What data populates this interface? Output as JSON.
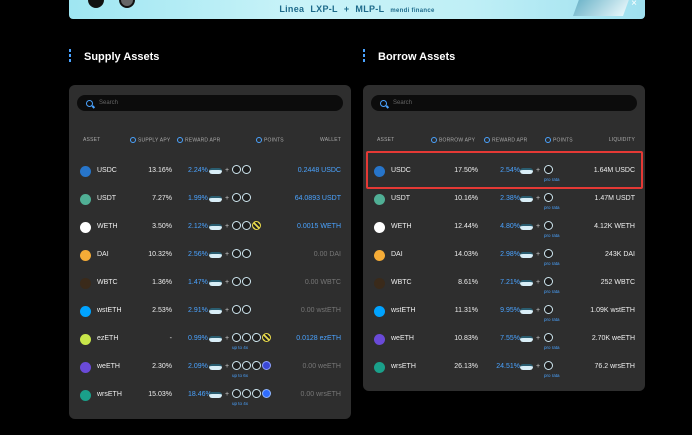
{
  "banner": {
    "left": "Linea",
    "mid1": "LXP-L",
    "plus": "+",
    "mid2": "MLP-L",
    "partner": "mendi finance",
    "close": "×"
  },
  "supply": {
    "title": "Supply Assets",
    "search_placeholder": "Search",
    "headers": {
      "asset": "ASSET",
      "apy": "SUPPLY APY",
      "reward": "REWARD APR",
      "points": "POINTS",
      "wallet": "WALLET"
    },
    "rows": [
      {
        "name": "USDC",
        "apy": "13.16%",
        "reward": "2.24%",
        "sub": "",
        "wallet": "0.2448 USDC",
        "wallet_blue": true,
        "icon_color": "#2775ca",
        "pts": [
          "n",
          "n"
        ]
      },
      {
        "name": "USDT",
        "apy": "7.27%",
        "reward": "1.99%",
        "sub": "",
        "wallet": "64.0893 USDT",
        "wallet_blue": true,
        "icon_color": "#50af95",
        "pts": [
          "n",
          "n"
        ]
      },
      {
        "name": "WETH",
        "apy": "3.50%",
        "reward": "2.12%",
        "sub": "",
        "wallet": "0.0015 WETH",
        "wallet_blue": true,
        "icon_color": "#ffffff",
        "pts": [
          "n",
          "n",
          "y"
        ]
      },
      {
        "name": "DAI",
        "apy": "10.32%",
        "reward": "2.56%",
        "sub": "",
        "wallet": "0.00 DAI",
        "wallet_blue": false,
        "icon_color": "#f5ac37",
        "pts": [
          "n",
          "n"
        ]
      },
      {
        "name": "WBTC",
        "apy": "1.36%",
        "reward": "1.47%",
        "sub": "",
        "wallet": "0.00 WBTC",
        "wallet_blue": false,
        "icon_color": "#3a2a1a",
        "pts": [
          "n",
          "n"
        ]
      },
      {
        "name": "wstETH",
        "apy": "2.53%",
        "reward": "2.91%",
        "sub": "",
        "wallet": "0.00 wstETH",
        "wallet_blue": false,
        "icon_color": "#00a3ff",
        "pts": [
          "n",
          "n"
        ]
      },
      {
        "name": "ezETH",
        "apy": "-",
        "reward": "0.99%",
        "sub": "up to 4x",
        "wallet": "0.0128 ezETH",
        "wallet_blue": true,
        "icon_color": "#c8e64a",
        "pts": [
          "n",
          "n",
          "n",
          "y"
        ]
      },
      {
        "name": "weETH",
        "apy": "2.30%",
        "reward": "2.09%",
        "sub": "up to 6x",
        "wallet": "0.00 weETH",
        "wallet_blue": false,
        "icon_color": "#6a4ad8",
        "pts": [
          "n",
          "n",
          "n",
          "p"
        ]
      },
      {
        "name": "wrsETH",
        "apy": "15.03%",
        "reward": "18.46%",
        "sub": "up to 4x",
        "wallet": "0.00 wrsETH",
        "wallet_blue": false,
        "icon_color": "#1aa08a",
        "pts": [
          "n",
          "n",
          "n",
          "b"
        ]
      }
    ]
  },
  "borrow": {
    "title": "Borrow Assets",
    "search_placeholder": "Search",
    "headers": {
      "asset": "ASSET",
      "apy": "BORROW APY",
      "reward": "REWARD APR",
      "points": "POINTS",
      "liquidity": "LIQUIDITY"
    },
    "rows": [
      {
        "name": "USDC",
        "apy": "17.50%",
        "reward": "2.54%",
        "sub": "pro rata",
        "liquidity": "1.64M USDC",
        "icon_color": "#2775ca"
      },
      {
        "name": "USDT",
        "apy": "10.16%",
        "reward": "2.38%",
        "sub": "pro rata",
        "liquidity": "1.47M USDT",
        "icon_color": "#50af95"
      },
      {
        "name": "WETH",
        "apy": "12.44%",
        "reward": "4.80%",
        "sub": "pro rata",
        "liquidity": "4.12K WETH",
        "icon_color": "#ffffff"
      },
      {
        "name": "DAI",
        "apy": "14.03%",
        "reward": "2.98%",
        "sub": "pro rata",
        "liquidity": "243K DAI",
        "icon_color": "#f5ac37"
      },
      {
        "name": "WBTC",
        "apy": "8.61%",
        "reward": "7.21%",
        "sub": "pro rata",
        "liquidity": "252 WBTC",
        "icon_color": "#3a2a1a"
      },
      {
        "name": "wstETH",
        "apy": "11.31%",
        "reward": "9.95%",
        "sub": "pro rata",
        "liquidity": "1.09K wstETH",
        "icon_color": "#00a3ff"
      },
      {
        "name": "weETH",
        "apy": "10.83%",
        "reward": "7.55%",
        "sub": "pro rata",
        "liquidity": "2.70K weETH",
        "icon_color": "#6a4ad8"
      },
      {
        "name": "wrsETH",
        "apy": "26.13%",
        "reward": "24.51%",
        "sub": "pro rata",
        "liquidity": "76.2 wrsETH",
        "icon_color": "#1aa08a"
      }
    ]
  },
  "highlight_color": "#e53935"
}
